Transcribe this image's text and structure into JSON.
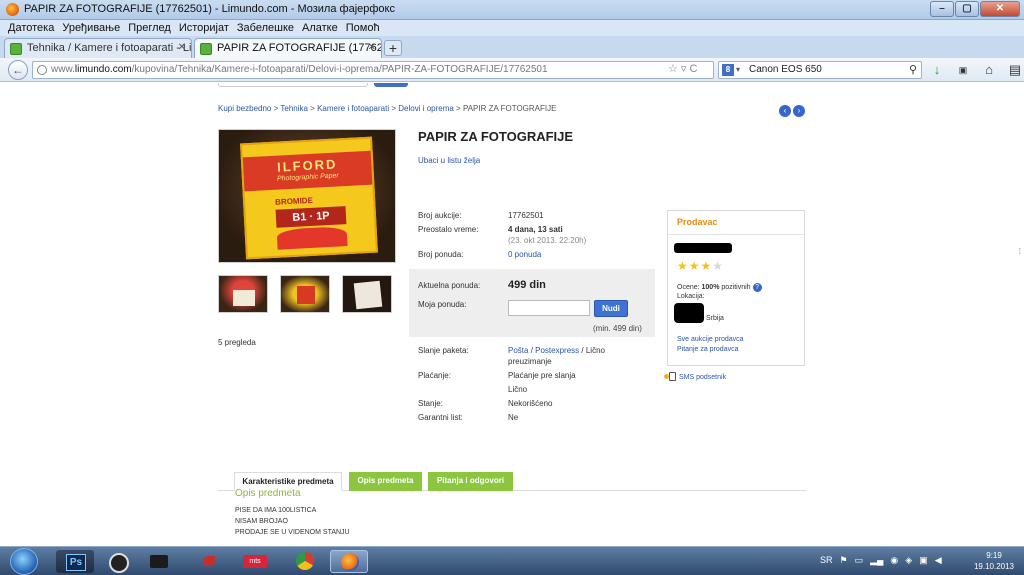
{
  "window": {
    "title": "PAPIR ZA FOTOGRAFIJE (17762501) - Limundo.com - Мозила фајерфокс",
    "minimize": "–",
    "maximize": "▢",
    "close": "✕"
  },
  "menu": [
    "Датотека",
    "Уређивање",
    "Преглед",
    "Историјат",
    "Забелешке",
    "Алатке",
    "Помоћ"
  ],
  "tabs": [
    {
      "label": "Tehnika / Kamere i fotoaparati - Limu..."
    },
    {
      "label": "PAPIR ZA FOTOGRAFIJE (17762501) - ..."
    }
  ],
  "new_tab": "+",
  "urlbar": {
    "url_prefix": "www.",
    "url_domain": "limundo.com",
    "url_path": "/kupovina/Tehnika/Kamere-i-fotoaparati/Delovi-i-oprema/PAPIR-ZA-FOTOGRAFIJE/17762501",
    "controls": "☆ ▿ C"
  },
  "search": {
    "engine": "8",
    "value": "Canon EOS 650"
  },
  "breadcrumb": {
    "items": [
      "Kupi bezbedno",
      "Tehnika",
      "Kamere i fotoaparati",
      "Delovi i oprema"
    ],
    "separator": " > ",
    "current": "PAPIR ZA FOTOGRAFIJE"
  },
  "pager": {
    "prev": "‹",
    "next": "›"
  },
  "product": {
    "title": "PAPIR ZA FOTOGRAFIJE",
    "wishlist": "Ubaci u listu želja",
    "views": "5 pregleda",
    "image": {
      "brand": "ILFORD",
      "sub": "Photographic Paper",
      "type": "BROMIDE",
      "grade": "B1 · 1P"
    }
  },
  "details": {
    "auction_label": "Broj aukcije:",
    "auction_value": "17762501",
    "remaining_label": "Preostalo vreme:",
    "remaining_value": "4 dana, 13 sati",
    "remaining_date": "(23. okt 2013. 22:20h)",
    "bids_label": "Broj ponuda:",
    "bids_value": "0 ponuda",
    "shipping_label": "Slanje paketa:",
    "shipping_posta": "Pošta",
    "shipping_sep": " / ",
    "shipping_postexpress": "Postexpress",
    "shipping_personal": " / Lično",
    "shipping_personal_2": "preuzimanje",
    "payment_label": "Plaćanje:",
    "payment_value_1": "Plaćanje pre slanja",
    "payment_value_2": "Lično",
    "condition_label": "Stanje:",
    "condition_value": "Nekorišćeno",
    "warranty_label": "Garantni list:",
    "warranty_value": "Ne"
  },
  "bid": {
    "current_label": "Aktuelna ponuda:",
    "current_value": "499 din",
    "my_label": "Moja ponuda:",
    "input_value": "",
    "button": "Nudi",
    "min": "(min. 499 din)"
  },
  "seller": {
    "header": "Prodavac",
    "stars_on": "★★★",
    "stars_off": "★",
    "rating_prefix": "Ocene: ",
    "rating_percent": "100%",
    "rating_suffix": " pozitivnih",
    "help": "?",
    "location_label": "Lokacija:",
    "location_value": "Srbija",
    "all_auctions": "Sve aukcije prodavca",
    "ask_seller": "Pitanje za prodavca"
  },
  "sms": "SMS podsetnik",
  "product_tabs": [
    "Karakteristike predmeta",
    "Opis predmeta",
    "Pitanja i odgovori"
  ],
  "description": {
    "title": "Opis predmeta",
    "lines": [
      "PISE DA IMA 100LISTICA",
      "NISAM BROJAO",
      "PRODAJE SE U VIDENOM STANJU"
    ]
  },
  "taskbar": {
    "tray_lang": "SR",
    "clock_time": "9:19",
    "clock_date": "19.10.2013"
  },
  "colors": {
    "link": "#2b56a8",
    "accent_green": "#8cc63e",
    "seller_orange": "#e48c14",
    "button_blue": "#3e73d4"
  }
}
